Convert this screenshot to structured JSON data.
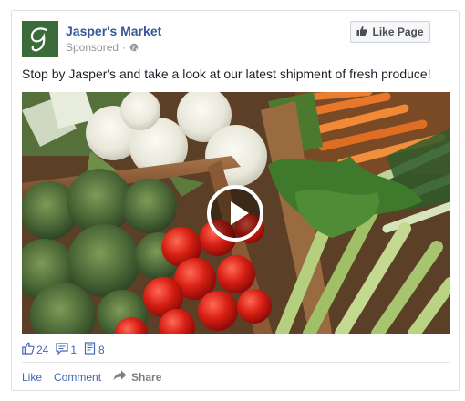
{
  "post": {
    "page_name": "Jasper's Market",
    "sponsored_label": "Sponsored",
    "separator": "·",
    "like_page_label": "Like Page",
    "text": "Stop by Jasper's and take a look at our latest shipment of fresh produce!"
  },
  "stats": {
    "likes": "24",
    "comments": "1",
    "shares": "8"
  },
  "actions": {
    "like": "Like",
    "comment": "Comment",
    "share": "Share"
  },
  "icons": {
    "logo": "jaspers-market-logo",
    "globe": "globe-icon",
    "thumbs_up": "thumbs-up-icon",
    "play": "play-icon",
    "comment": "comment-icon",
    "share_count": "share-count-icon",
    "share_arrow": "share-arrow-icon"
  },
  "colors": {
    "link_blue": "#365899",
    "action_blue": "#4267b2",
    "logo_green": "#3c6b3a",
    "muted_gray": "#90949c"
  }
}
